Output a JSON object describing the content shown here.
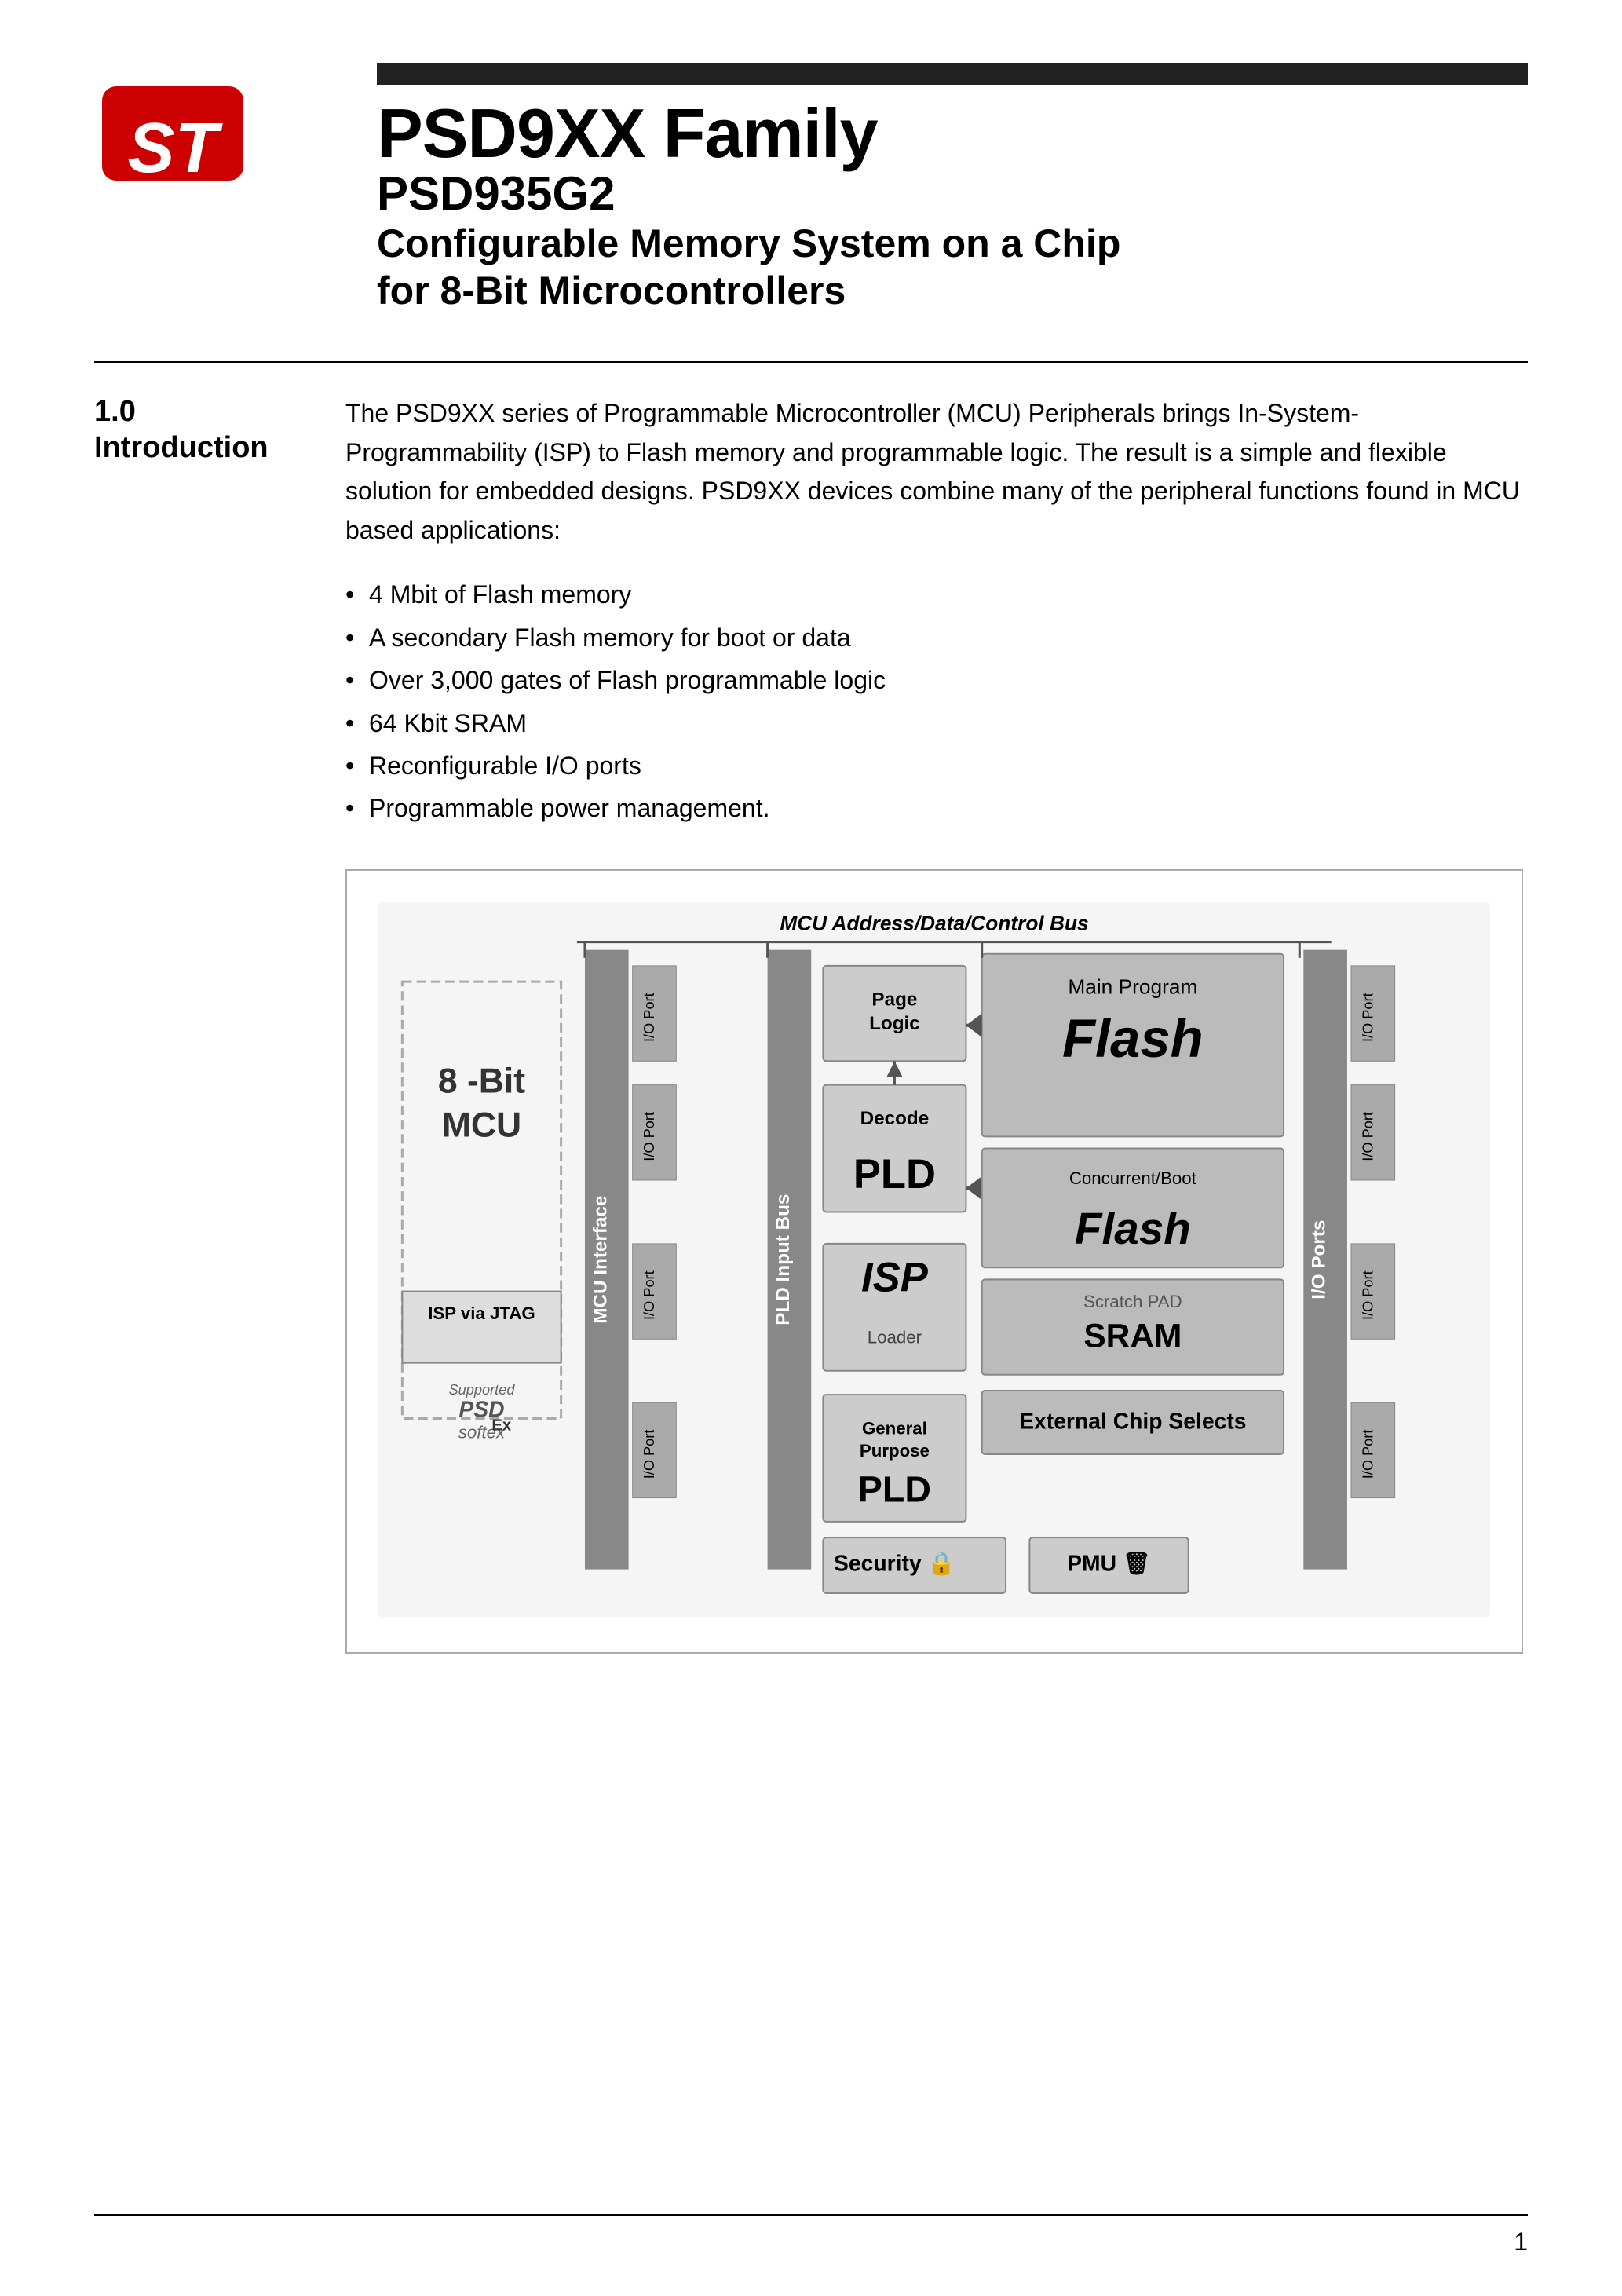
{
  "header": {
    "bar_label": "",
    "family": "PSD9XX Family",
    "product_number": "PSD935G2",
    "subtitle_line1": "Configurable Memory System on a Chip",
    "subtitle_line2": "for 8-Bit Microcontrollers"
  },
  "section": {
    "number": "1.0",
    "title": "Introduction",
    "intro": "The PSD9XX series of Programmable Microcontroller (MCU) Peripherals brings In-System-Programmability (ISP) to Flash memory and programmable logic. The result is a simple and flexible solution for embedded designs. PSD9XX devices combine many of the peripheral functions found in MCU based applications:",
    "bullets": [
      "4 Mbit of Flash memory",
      "A secondary Flash memory for boot or data",
      "Over 3,000 gates of Flash programmable logic",
      "64 Kbit SRAM",
      "Reconfigurable I/O ports",
      "Programmable power management."
    ]
  },
  "diagram": {
    "title": "MCU Address/Data/Control Bus",
    "mcu_label": "8 -Bit\nMCU",
    "mcu_interface": "MCU Interface",
    "page_logic": "Page\nLogic",
    "main_program": "Main Program",
    "flash_main": "Flash",
    "decode": "Decode",
    "pld_decode": "PLD",
    "concurrent_boot": "Concurrent/Boot",
    "flash_boot": "Flash",
    "scratch_pad": "Scratch PAD",
    "sram": "SRAM",
    "isp_jtag": "ISP via JTAG",
    "isp": "ISP",
    "loader": "Loader",
    "general_purpose": "General\nPurpose",
    "external_chip_selects": "External Chip Selects",
    "pld_gp": "PLD",
    "security": "Security",
    "pmu": "PMU",
    "pld_input_bus": "PLD Input Bus",
    "io_port_labels": [
      "I/O Port",
      "I/O Port",
      "I/O Port",
      "I/O Port",
      "I/O Port",
      "I/O Port",
      "I/O Port",
      "I/O Port"
    ],
    "supported_label": "Supported"
  },
  "footer": {
    "page_number": "1"
  }
}
